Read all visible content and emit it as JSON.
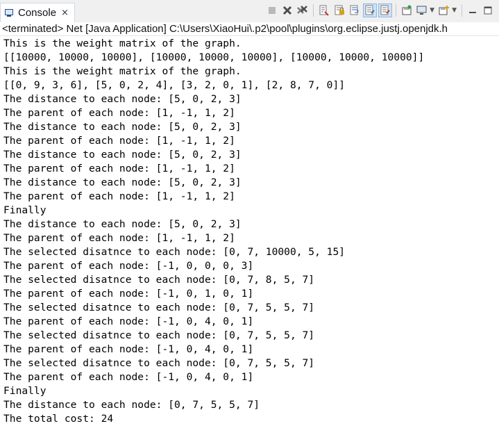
{
  "tab": {
    "icon": "console-icon",
    "label": "Console",
    "close_symbol": "×"
  },
  "toolbar": {
    "icons": [
      "terminate-icon",
      "remove-launch-icon",
      "remove-all-launches-icon",
      "clear-console-icon",
      "scroll-lock-icon",
      "word-wrap-icon",
      "show-on-stdout-icon",
      "show-on-stderr-icon",
      "pin-console-icon",
      "display-selected-console-icon",
      "open-console-icon",
      "minimize-icon",
      "maximize-icon"
    ]
  },
  "status": {
    "text": "<terminated> Net [Java Application] C:\\Users\\XiaoHui\\.p2\\pool\\plugins\\org.eclipse.justj.openjdk.h"
  },
  "console": {
    "lines": [
      "This is the weight matrix of the graph.",
      "[[10000, 10000, 10000], [10000, 10000, 10000], [10000, 10000, 10000]]",
      "This is the weight matrix of the graph.",
      "[[0, 9, 3, 6], [5, 0, 2, 4], [3, 2, 0, 1], [2, 8, 7, 0]]",
      "The distance to each node: [5, 0, 2, 3]",
      "The parent of each node: [1, -1, 1, 2]",
      "The distance to each node: [5, 0, 2, 3]",
      "The parent of each node: [1, -1, 1, 2]",
      "The distance to each node: [5, 0, 2, 3]",
      "The parent of each node: [1, -1, 1, 2]",
      "The distance to each node: [5, 0, 2, 3]",
      "The parent of each node: [1, -1, 1, 2]",
      "Finally",
      "The distance to each node: [5, 0, 2, 3]",
      "The parent of each node: [1, -1, 1, 2]",
      "The selected disatnce to each node: [0, 7, 10000, 5, 15]",
      "The parent of each node: [-1, 0, 0, 0, 3]",
      "The selected disatnce to each node: [0, 7, 8, 5, 7]",
      "The parent of each node: [-1, 0, 1, 0, 1]",
      "The selected disatnce to each node: [0, 7, 5, 5, 7]",
      "The parent of each node: [-1, 0, 4, 0, 1]",
      "The selected disatnce to each node: [0, 7, 5, 5, 7]",
      "The parent of each node: [-1, 0, 4, 0, 1]",
      "The selected disatnce to each node: [0, 7, 5, 5, 7]",
      "The parent of each node: [-1, 0, 4, 0, 1]",
      "Finally",
      "The distance to each node: [0, 7, 5, 5, 7]",
      "The total cost: 24"
    ]
  },
  "colors": {
    "tab_border": "#cfd8e6",
    "toolbar_active": "#cde3f7",
    "text": "#000000"
  }
}
